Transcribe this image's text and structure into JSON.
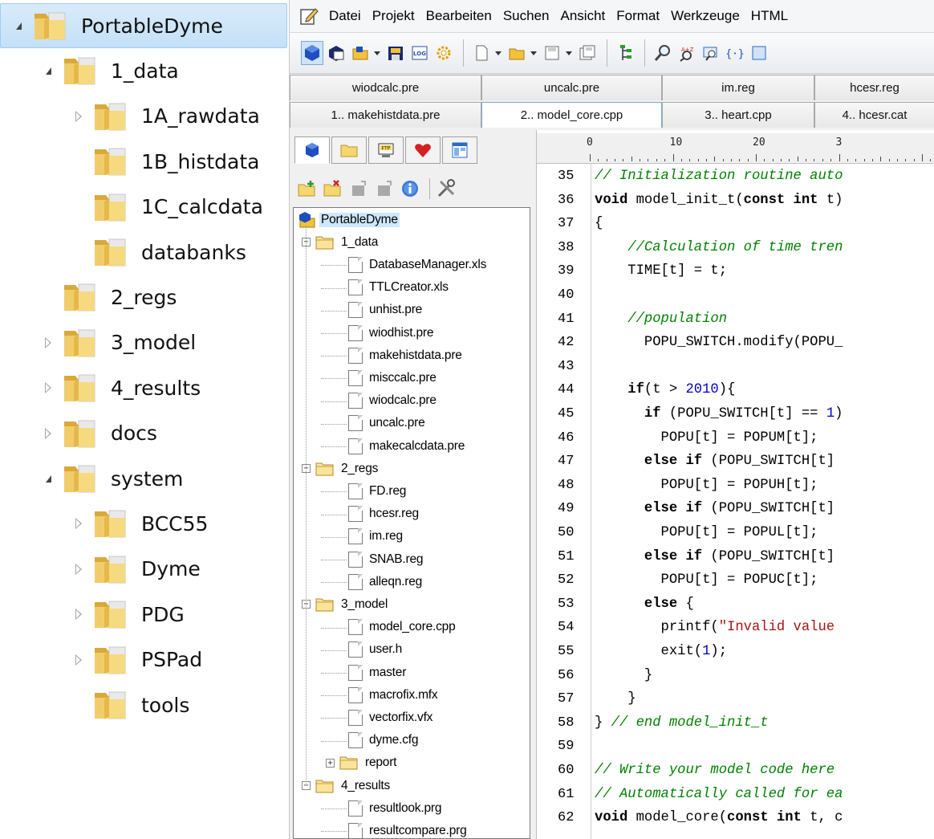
{
  "explorer": {
    "items": [
      {
        "label": "PortableDyme",
        "state": "open",
        "selected": true
      },
      {
        "label": "1_data",
        "state": "open"
      },
      {
        "label": "1A_rawdata",
        "state": "closed"
      },
      {
        "label": "1B_histdata",
        "state": "none"
      },
      {
        "label": "1C_calcdata",
        "state": "none"
      },
      {
        "label": "databanks",
        "state": "none"
      },
      {
        "label": "2_regs",
        "state": "none"
      },
      {
        "label": "3_model",
        "state": "closed"
      },
      {
        "label": "4_results",
        "state": "closed"
      },
      {
        "label": "docs",
        "state": "closed"
      },
      {
        "label": "system",
        "state": "open"
      },
      {
        "label": "BCC55",
        "state": "closed"
      },
      {
        "label": "Dyme",
        "state": "closed"
      },
      {
        "label": "PDG",
        "state": "closed"
      },
      {
        "label": "PSPad",
        "state": "closed"
      },
      {
        "label": "tools",
        "state": "none"
      }
    ]
  },
  "menubar": {
    "items": [
      "Datei",
      "Projekt",
      "Bearbeiten",
      "Suchen",
      "Ansicht",
      "Format",
      "Werkzeuge",
      "HTML"
    ]
  },
  "tabs": {
    "row1": [
      "wiodcalc.pre",
      "uncalc.pre",
      "im.reg",
      "hcesr.reg"
    ],
    "row2": [
      "1.. makehistdata.pre",
      "2.. model_core.cpp",
      "3.. heart.cpp",
      "4.. hcesr.cat"
    ],
    "active": "2.. model_core.cpp"
  },
  "project_tree": {
    "root": "PortableDyme",
    "nodes": [
      {
        "label": "1_data",
        "type": "folder",
        "level": 1,
        "expanded": true
      },
      {
        "label": "DatabaseManager.xls",
        "type": "file",
        "level": 2
      },
      {
        "label": "TTLCreator.xls",
        "type": "file",
        "level": 2
      },
      {
        "label": "unhist.pre",
        "type": "file",
        "level": 2
      },
      {
        "label": "wiodhist.pre",
        "type": "file",
        "level": 2
      },
      {
        "label": "makehistdata.pre",
        "type": "file",
        "level": 2
      },
      {
        "label": "misccalc.pre",
        "type": "file",
        "level": 2
      },
      {
        "label": "wiodcalc.pre",
        "type": "file",
        "level": 2
      },
      {
        "label": "uncalc.pre",
        "type": "file",
        "level": 2
      },
      {
        "label": "makecalcdata.pre",
        "type": "file",
        "level": 2
      },
      {
        "label": "2_regs",
        "type": "folder",
        "level": 1,
        "expanded": true
      },
      {
        "label": "FD.reg",
        "type": "file",
        "level": 2
      },
      {
        "label": "hcesr.reg",
        "type": "file",
        "level": 2
      },
      {
        "label": "im.reg",
        "type": "file",
        "level": 2
      },
      {
        "label": "SNAB.reg",
        "type": "file",
        "level": 2
      },
      {
        "label": "alleqn.reg",
        "type": "file",
        "level": 2
      },
      {
        "label": "3_model",
        "type": "folder",
        "level": 1,
        "expanded": true
      },
      {
        "label": "model_core.cpp",
        "type": "file",
        "level": 2
      },
      {
        "label": "user.h",
        "type": "file",
        "level": 2
      },
      {
        "label": "master",
        "type": "file",
        "level": 2
      },
      {
        "label": "macrofix.mfx",
        "type": "file",
        "level": 2
      },
      {
        "label": "vectorfix.vfx",
        "type": "file",
        "level": 2
      },
      {
        "label": "dyme.cfg",
        "type": "file",
        "level": 2
      },
      {
        "label": "report",
        "type": "folder",
        "level": 2,
        "expanded": false
      },
      {
        "label": "4_results",
        "type": "folder",
        "level": 1,
        "expanded": true
      },
      {
        "label": "resultlook.prg",
        "type": "file",
        "level": 2
      },
      {
        "label": "resultcompare.prg",
        "type": "file",
        "level": 2
      }
    ]
  },
  "ruler": {
    "labels": [
      "0",
      "10",
      "20",
      "3"
    ]
  },
  "code": {
    "lines": [
      {
        "n": "35",
        "parts": [
          {
            "t": "// Initialization routine auto",
            "c": "cm"
          }
        ]
      },
      {
        "n": "36",
        "parts": [
          {
            "t": "void",
            "c": "kw"
          },
          {
            "t": " model_init_t(",
            "c": ""
          },
          {
            "t": "const int",
            "c": "kw"
          },
          {
            "t": " t)",
            "c": ""
          }
        ]
      },
      {
        "n": "37",
        "parts": [
          {
            "t": "{",
            "c": ""
          }
        ]
      },
      {
        "n": "38",
        "parts": [
          {
            "t": "    //Calculation of time tren",
            "c": "cm"
          }
        ]
      },
      {
        "n": "39",
        "parts": [
          {
            "t": "    TIME[t] = t;",
            "c": ""
          }
        ]
      },
      {
        "n": "40",
        "parts": []
      },
      {
        "n": "41",
        "parts": [
          {
            "t": "    //population",
            "c": "cm"
          }
        ]
      },
      {
        "n": "42",
        "parts": [
          {
            "t": "      POPU_SWITCH.modify(POPU_",
            "c": ""
          }
        ]
      },
      {
        "n": "43",
        "parts": []
      },
      {
        "n": "44",
        "parts": [
          {
            "t": "    ",
            "c": ""
          },
          {
            "t": "if",
            "c": "kw"
          },
          {
            "t": "(t > ",
            "c": ""
          },
          {
            "t": "2010",
            "c": "nm"
          },
          {
            "t": "){",
            "c": ""
          }
        ]
      },
      {
        "n": "45",
        "parts": [
          {
            "t": "      ",
            "c": ""
          },
          {
            "t": "if",
            "c": "kw"
          },
          {
            "t": " (POPU_SWITCH[t] == ",
            "c": ""
          },
          {
            "t": "1",
            "c": "nm"
          },
          {
            "t": ")",
            "c": ""
          }
        ]
      },
      {
        "n": "46",
        "parts": [
          {
            "t": "        POPU[t] = POPUM[t];",
            "c": ""
          }
        ]
      },
      {
        "n": "47",
        "parts": [
          {
            "t": "      ",
            "c": ""
          },
          {
            "t": "else if",
            "c": "kw"
          },
          {
            "t": " (POPU_SWITCH[t]",
            "c": ""
          }
        ]
      },
      {
        "n": "48",
        "parts": [
          {
            "t": "        POPU[t] = POPUH[t];",
            "c": ""
          }
        ]
      },
      {
        "n": "49",
        "parts": [
          {
            "t": "      ",
            "c": ""
          },
          {
            "t": "else if",
            "c": "kw"
          },
          {
            "t": " (POPU_SWITCH[t]",
            "c": ""
          }
        ]
      },
      {
        "n": "50",
        "parts": [
          {
            "t": "        POPU[t] = POPUL[t];",
            "c": ""
          }
        ]
      },
      {
        "n": "51",
        "parts": [
          {
            "t": "      ",
            "c": ""
          },
          {
            "t": "else if",
            "c": "kw"
          },
          {
            "t": " (POPU_SWITCH[t]",
            "c": ""
          }
        ]
      },
      {
        "n": "52",
        "parts": [
          {
            "t": "        POPU[t] = POPUC[t];",
            "c": ""
          }
        ]
      },
      {
        "n": "53",
        "parts": [
          {
            "t": "      ",
            "c": ""
          },
          {
            "t": "else",
            "c": "kw"
          },
          {
            "t": " {",
            "c": ""
          }
        ]
      },
      {
        "n": "54",
        "parts": [
          {
            "t": "        printf(",
            "c": ""
          },
          {
            "t": "\"Invalid value",
            "c": "st"
          }
        ]
      },
      {
        "n": "55",
        "parts": [
          {
            "t": "        exit(",
            "c": ""
          },
          {
            "t": "1",
            "c": "nm"
          },
          {
            "t": ");",
            "c": ""
          }
        ]
      },
      {
        "n": "56",
        "parts": [
          {
            "t": "      }",
            "c": ""
          }
        ]
      },
      {
        "n": "57",
        "parts": [
          {
            "t": "    }",
            "c": ""
          }
        ]
      },
      {
        "n": "58",
        "parts": [
          {
            "t": "} ",
            "c": ""
          },
          {
            "t": "// end model_init_t",
            "c": "cm"
          }
        ]
      },
      {
        "n": "59",
        "parts": []
      },
      {
        "n": "60",
        "parts": [
          {
            "t": "// Write your model code here",
            "c": "cm"
          }
        ]
      },
      {
        "n": "61",
        "parts": [
          {
            "t": "// Automatically called for ea",
            "c": "cm"
          }
        ]
      },
      {
        "n": "62",
        "parts": [
          {
            "t": "void",
            "c": "kw"
          },
          {
            "t": " model_core(",
            "c": ""
          },
          {
            "t": "const int",
            "c": "kw"
          },
          {
            "t": " t, c",
            "c": ""
          }
        ]
      }
    ]
  },
  "colors": {
    "folder": "#e8c25a",
    "selection": "#cde8fb",
    "comment": "#008000"
  }
}
